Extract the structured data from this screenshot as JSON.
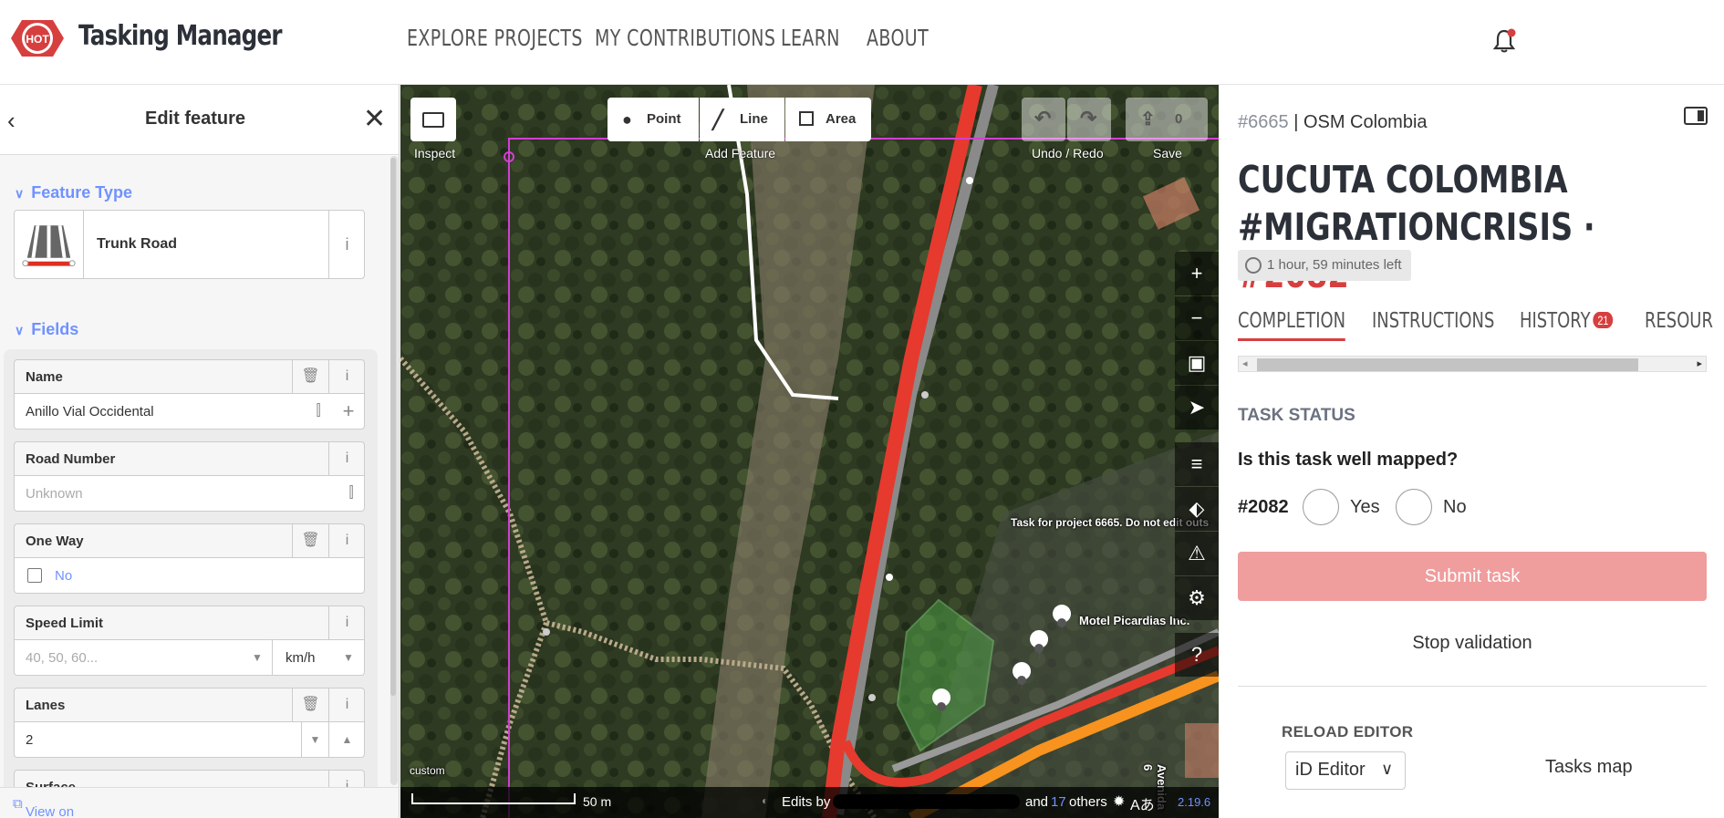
{
  "nav": {
    "brand": "Tasking Manager",
    "logo_text": "HOT",
    "links": [
      "EXPLORE PROJECTS",
      "MY CONTRIBUTIONS",
      "LEARN",
      "ABOUT"
    ],
    "notification_icon": "bell-icon"
  },
  "left_panel": {
    "title": "Edit feature",
    "feature_type_section": "Feature Type",
    "feature_type": "Trunk Road",
    "fields_section": "Fields",
    "fields": {
      "name": {
        "label": "Name",
        "value": "Anillo Vial Occidental"
      },
      "road_number": {
        "label": "Road Number",
        "placeholder": "Unknown"
      },
      "one_way": {
        "label": "One Way",
        "value": "No"
      },
      "speed_limit": {
        "label": "Speed Limit",
        "placeholder": "40, 50, 60...",
        "unit": "km/h"
      },
      "lanes": {
        "label": "Lanes",
        "value": "2"
      },
      "surface": {
        "label": "Surface"
      }
    },
    "footer_link": "View on openstreetmap.org"
  },
  "map": {
    "toolbar": {
      "inspect_label": "Inspect",
      "point": "Point",
      "line": "Line",
      "area": "Area",
      "add_feature_label": "Add Feature",
      "undo_redo_label": "Undo / Redo",
      "save_label": "Save",
      "save_count": "0"
    },
    "labels": {
      "task_note": "Task for project 6665. Do not edit outs",
      "poi": "Motel Picardias Inc.",
      "street": "Avenida 6",
      "imagery": "custom"
    },
    "footer": {
      "scale": "50 m",
      "edits_by": "Edits by",
      "and": "and",
      "others_count": "17",
      "others": "others",
      "version": "2.19.6"
    }
  },
  "right_panel": {
    "project_id": "#6665",
    "org": "| OSM Colombia",
    "title_line1": "CUCUTA COLOMBIA",
    "title_line2": "#MIGRATIONCRISIS",
    "title_sep": "·",
    "task_id": "#2082",
    "time_left": "1 hour, 59 minutes left",
    "tabs": {
      "completion": "COMPLETION",
      "instructions": "INSTRUCTIONS",
      "history": "HISTORY",
      "history_count": "21",
      "resources": "RESOUR"
    },
    "task_status": "TASK STATUS",
    "question": "Is this task well mapped?",
    "task_number": "#2082",
    "yes": "Yes",
    "no": "No",
    "submit": "Submit task",
    "stop": "Stop validation",
    "reload_editor": "RELOAD EDITOR",
    "editor": "iD Editor",
    "tasks_map": "Tasks map"
  },
  "colors": {
    "accent": "#d73f3f",
    "id_blue": "#7092ff",
    "submit_disabled": "#ef9d9d"
  }
}
